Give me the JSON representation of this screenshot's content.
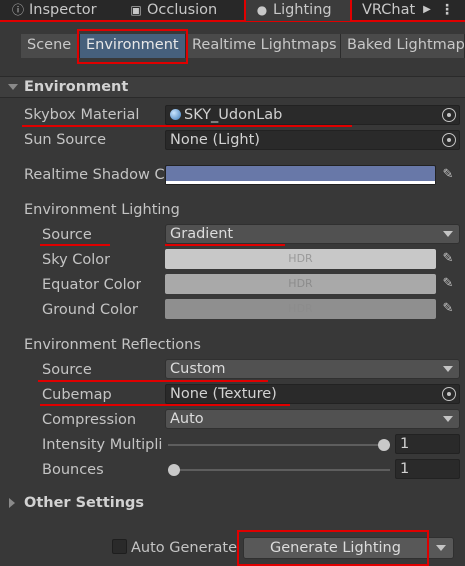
{
  "tabs": [
    {
      "label": "Inspector",
      "icon": "info-icon"
    },
    {
      "label": "Occlusion",
      "icon": "occlusion-icon"
    },
    {
      "label": "Lighting",
      "icon": "bulb-icon"
    },
    {
      "label": "VRChat",
      "icon": "vrchat-icon"
    }
  ],
  "subtabs": [
    "Scene",
    "Environment",
    "Realtime Lightmaps",
    "Baked Lightmap"
  ],
  "section": {
    "title": "Environment"
  },
  "environment": {
    "skybox_label": "Skybox Material",
    "skybox_value": "SKY_UdonLab",
    "sun_label": "Sun Source",
    "sun_value": "None (Light)",
    "shadow_label": "Realtime Shadow C",
    "shadow_color": "#6878a8"
  },
  "env_lighting": {
    "header": "Environment Lighting",
    "source_label": "Source",
    "source_value": "Gradient",
    "sky_label": "Sky Color",
    "sky_hdr": "HDR",
    "sky_color": "#c8c8c8",
    "equator_label": "Equator Color",
    "equator_hdr": "HDR",
    "equator_color": "#a9a9a9",
    "ground_label": "Ground Color",
    "ground_hdr": "HDR",
    "ground_color": "#8f8f8f"
  },
  "env_reflections": {
    "header": "Environment Reflections",
    "source_label": "Source",
    "source_value": "Custom",
    "cubemap_label": "Cubemap",
    "cubemap_value": "None (Texture)",
    "compression_label": "Compression",
    "compression_value": "Auto",
    "intensity_label": "Intensity Multipli",
    "intensity_value": "1",
    "intensity_fraction": 1.0,
    "bounces_label": "Bounces",
    "bounces_value": "1",
    "bounces_fraction": 0.0
  },
  "other_settings": {
    "title": "Other Settings"
  },
  "footer": {
    "auto_generate_label": "Auto Generate",
    "generate_button": "Generate Lighting"
  },
  "colors": {
    "highlight": "#e00000",
    "active_tab": "#46607c"
  }
}
